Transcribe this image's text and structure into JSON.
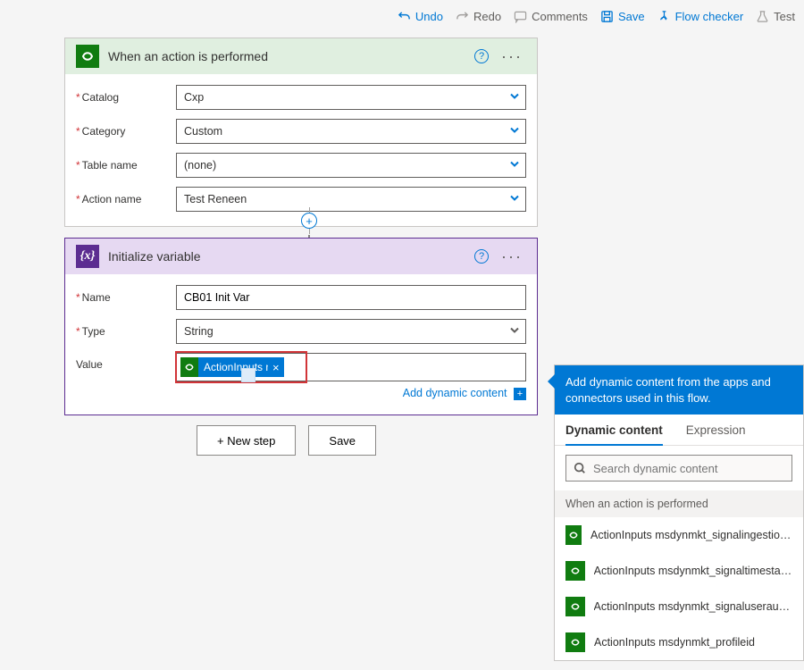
{
  "toolbar": {
    "undo": "Undo",
    "redo": "Redo",
    "comments": "Comments",
    "save": "Save",
    "flowchecker": "Flow checker",
    "test": "Test"
  },
  "trigger": {
    "title": "When an action is performed",
    "fields": {
      "catalog_label": "Catalog",
      "catalog_value": "Cxp",
      "category_label": "Category",
      "category_value": "Custom",
      "table_label": "Table name",
      "table_value": "(none)",
      "action_label": "Action name",
      "action_value": "Test Reneen"
    }
  },
  "variable": {
    "title": "Initialize variable",
    "name_label": "Name",
    "name_value": "CB01 Init Var",
    "type_label": "Type",
    "type_value": "String",
    "value_label": "Value",
    "token_label": "ActionInputs m…",
    "add_dynamic": "Add dynamic content"
  },
  "footer": {
    "new_step": "+ New step",
    "save": "Save"
  },
  "popout": {
    "header": "Add dynamic content from the apps and connectors used in this flow.",
    "tab_dynamic": "Dynamic content",
    "tab_expression": "Expression",
    "search_placeholder": "Search dynamic content",
    "group": "When an action is performed",
    "items": [
      "ActionInputs msdynmkt_signalingestiontimestamp",
      "ActionInputs msdynmkt_signaltimestamp",
      "ActionInputs msdynmkt_signaluserauthid",
      "ActionInputs msdynmkt_profileid"
    ]
  }
}
